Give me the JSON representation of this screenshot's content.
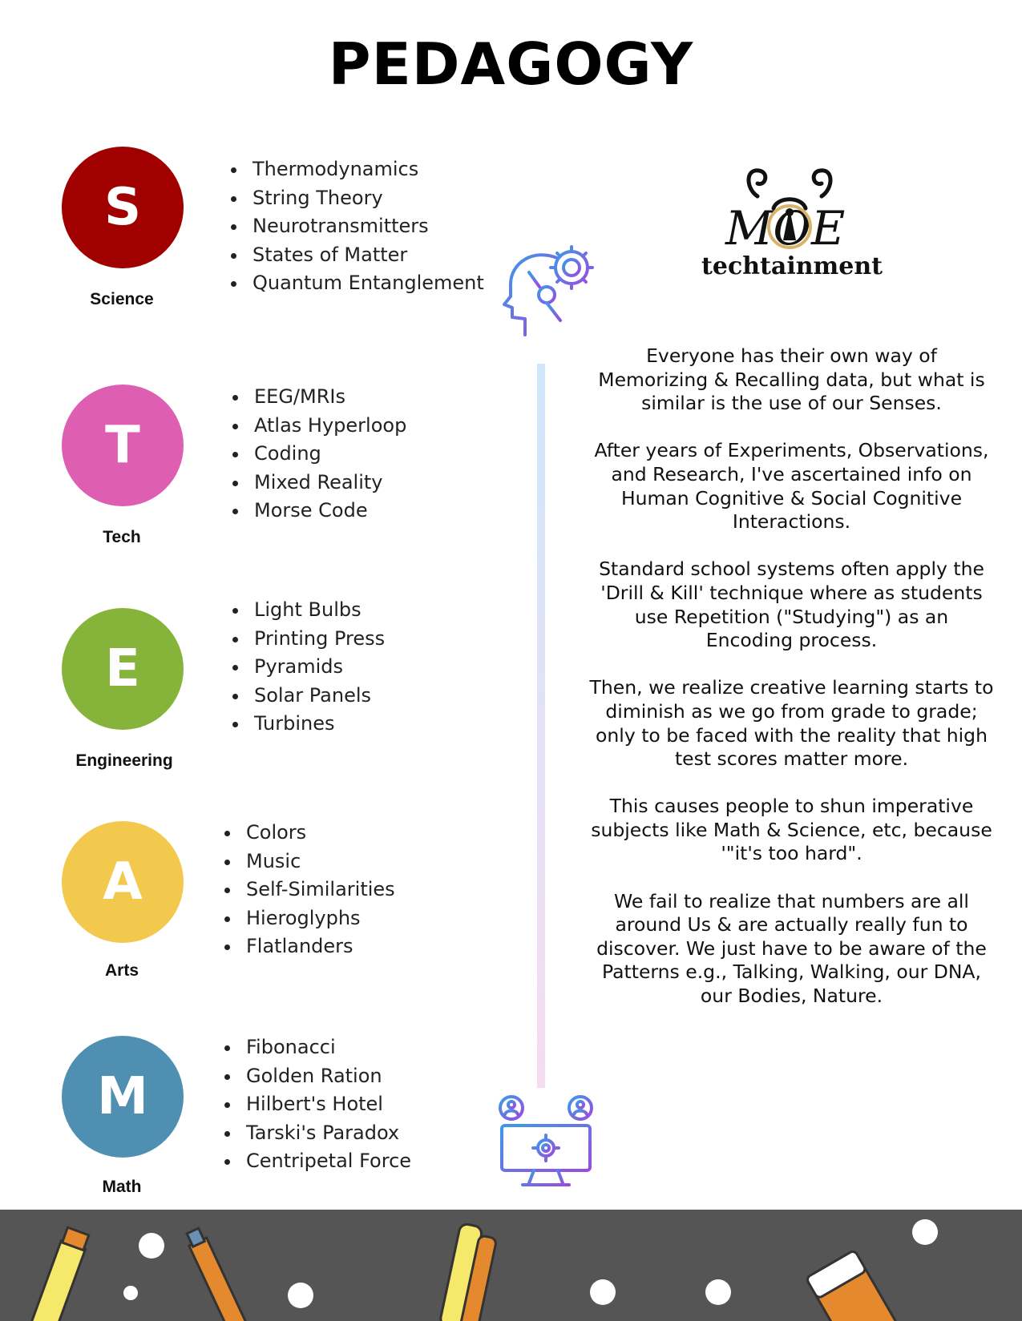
{
  "title": "PEDAGOGY",
  "stem": [
    {
      "letter": "S",
      "label": "Science",
      "color": "#a00000",
      "items": [
        "Thermodynamics",
        "String Theory",
        "Neurotransmitters",
        "States of Matter",
        "Quantum Entanglement"
      ]
    },
    {
      "letter": "T",
      "label": "Tech",
      "color": "#de5fb2",
      "items": [
        "EEG/MRIs",
        "Atlas Hyperloop",
        "Coding",
        "Mixed Reality",
        "Morse Code"
      ]
    },
    {
      "letter": "E",
      "label": "Engineering",
      "color": "#86b33a",
      "items": [
        "Light Bulbs",
        "Printing Press",
        "Pyramids",
        "Solar Panels",
        "Turbines"
      ]
    },
    {
      "letter": "A",
      "label": "Arts",
      "color": "#f2c94c",
      "items": [
        "Colors",
        "Music",
        "Self-Similarities",
        "Hieroglyphs",
        "Flatlanders"
      ]
    },
    {
      "letter": "M",
      "label": "Math",
      "color": "#4f8fb2",
      "items": [
        "Fibonacci",
        "Golden Ration",
        "Hilbert's Hotel",
        "Tarski's Paradox",
        "Centripetal Force"
      ]
    }
  ],
  "logo": {
    "letters": "MOE",
    "text": "techtainment"
  },
  "paragraphs": [
    "Everyone has their own way of Memorizing & Recalling data, but what is similar is the use of our Senses.",
    "After years of Experiments, Observations, and Research, I've ascertained info on Human Cognitive & Social Cognitive Interactions.",
    "Standard school systems often apply the 'Drill & Kill' technique where as students use Repetition (\"Studying\") as an Encoding process.",
    "Then, we realize creative learning starts to diminish as we go from grade to grade; only to be faced with the reality that high test scores matter more.",
    "This causes people to shun imperative subjects like Math & Science, etc, because '\"it's too hard\".",
    "We fail to realize that numbers are all around Us & are actually really fun to discover. We just have to be aware of the Patterns e.g., Talking, Walking,  our DNA, our Bodies, Nature."
  ],
  "icons": {
    "top": "robot-head-gear-icon",
    "bottom": "computer-network-gear-icon"
  },
  "colors": {
    "footer": "#555555",
    "timeline_top": "#cfe6fb",
    "timeline_bottom": "#f6dcf0"
  }
}
